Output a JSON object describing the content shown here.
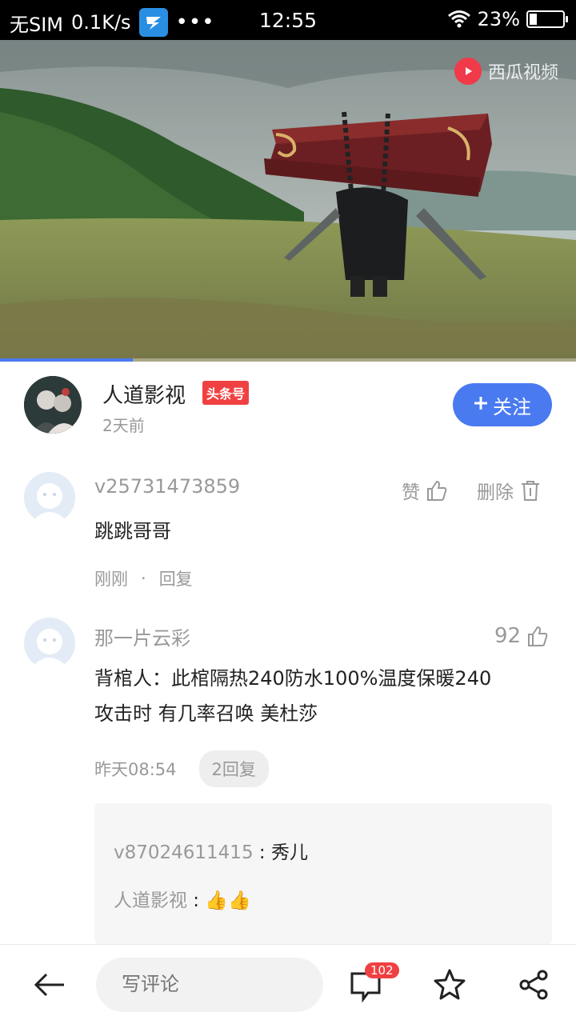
{
  "status_bar": {
    "carrier": "无SIM",
    "speed": "0.1K/s",
    "dots": "•••",
    "time": "12:55",
    "battery": "23%",
    "battery_level": 0.23
  },
  "video": {
    "watermark": "西瓜视频",
    "progress": 0.23
  },
  "author": {
    "name": "人道影视",
    "tag": "头条号",
    "time": "2天前",
    "follow_label": "关注"
  },
  "comments": [
    {
      "user": "v25731473859",
      "text": "跳跳哥哥",
      "time": "刚刚",
      "sep": "·",
      "reply": "回复",
      "like_label": "赞",
      "delete_label": "删除"
    },
    {
      "user": "那一片云彩",
      "text_line1": "背棺人：此棺隔热240防水100%温度保暖240",
      "text_line2": "攻击时 有几率召唤 美杜莎",
      "time": "昨天08:54",
      "reply_count": "2回复",
      "likes": "92",
      "replies": [
        {
          "user": "v87024611415",
          "sep": " : ",
          "text": "秀儿"
        },
        {
          "user": "人道影视",
          "sep": " : ",
          "text": "👍👍"
        }
      ]
    }
  ],
  "bottom_bar": {
    "input_placeholder": "写评论",
    "comment_count": "102"
  },
  "colors": {
    "accent": "#4a7af0",
    "badge_red": "#f04142",
    "muted_text": "#999999"
  }
}
